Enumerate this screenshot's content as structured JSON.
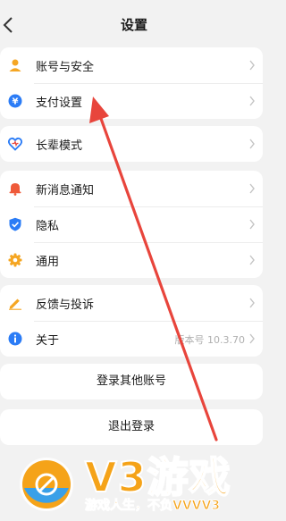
{
  "header": {
    "title": "设置"
  },
  "groups": {
    "account": [
      {
        "label": "账号与安全",
        "icon": "user-icon"
      },
      {
        "label": "支付设置",
        "icon": "yen-icon"
      }
    ],
    "elder": [
      {
        "label": "长辈模式",
        "icon": "heart-icon"
      }
    ],
    "general": [
      {
        "label": "新消息通知",
        "icon": "bell-icon"
      },
      {
        "label": "隐私",
        "icon": "shield-icon"
      },
      {
        "label": "通用",
        "icon": "gear-icon"
      }
    ],
    "about": [
      {
        "label": "反馈与投诉",
        "icon": "pen-icon"
      },
      {
        "label": "关于",
        "icon": "info-icon",
        "value": "版本号 10.3.70"
      }
    ]
  },
  "buttons": {
    "switch_account": "登录其他账号",
    "logout": "退出登录"
  },
  "watermark": {
    "logo_text": "V3游戏",
    "slogan": "游戏人生，不负VVVV3"
  },
  "colors": {
    "accent_blue": "#2b7cf6",
    "arrow_red": "#e8453c",
    "watermark_orange": "#f5a319"
  }
}
